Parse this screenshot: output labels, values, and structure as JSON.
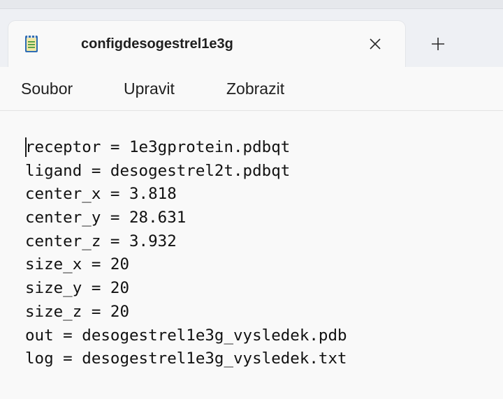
{
  "tab": {
    "title": "configdesogestrel1e3g",
    "icon": "notepad-icon",
    "close_icon": "close-icon",
    "new_tab_icon": "plus-icon"
  },
  "menu": {
    "items": [
      "Soubor",
      "Upravit",
      "Zobrazit"
    ]
  },
  "editor": {
    "lines": [
      "receptor = 1e3gprotein.pdbqt",
      "ligand = desogestrel2t.pdbqt",
      "center_x = 3.818",
      "center_y = 28.631",
      "center_z = 3.932",
      "size_x = 20",
      "size_y = 20",
      "size_z = 20",
      "out = desogestrel1e3g_vysledek.pdb",
      "log = desogestrel1e3g_vysledek.txt"
    ]
  },
  "colors": {
    "titlebar_bg": "#eef0f4",
    "tab_bg": "#f9f9f9",
    "editor_bg": "#f9f9f9",
    "text": "#111111",
    "icon_accent": "#3c8c3a"
  }
}
